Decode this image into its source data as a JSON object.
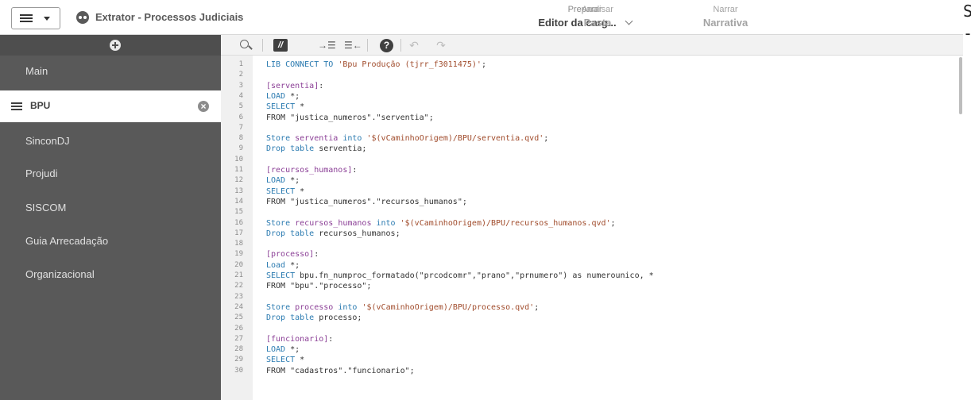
{
  "header": {
    "app_title": "Extrator - Processos Judiciais",
    "steps": [
      {
        "label": "Preparar",
        "value": "Editor da carg..."
      },
      {
        "label": "Analisar",
        "value": "Pasta"
      },
      {
        "label": "Narrar",
        "value": "Narrativa"
      }
    ],
    "edge_text": "S\n-"
  },
  "sidebar": {
    "items": [
      {
        "label": "Main",
        "active": false
      },
      {
        "label": "BPU",
        "active": true
      },
      {
        "label": "SinconDJ",
        "active": false
      },
      {
        "label": "Projudi",
        "active": false
      },
      {
        "label": "SISCOM",
        "active": false
      },
      {
        "label": "Guia Arrecadação",
        "active": false
      },
      {
        "label": "Organizacional",
        "active": false
      }
    ]
  },
  "toolbar": {
    "comment_glyph": "//",
    "indent_glyph": "→☰",
    "outdent_glyph": "☰←",
    "help_glyph": "?",
    "undo_glyph": "↶",
    "redo_glyph": "↷"
  },
  "colors": {
    "sidebar_bg": "#595959",
    "active_item_bg": "#ffffff",
    "keyword": "#2a7ab0",
    "label": "#8b3f96",
    "string": "#a04b2b"
  },
  "editor": {
    "lines": [
      {
        "n": "1",
        "parts": [
          [
            "kw",
            "LIB CONNECT TO "
          ],
          [
            "str",
            "'Bpu Produção (tjrr_f3011475)'"
          ],
          [
            "",
            "; "
          ]
        ]
      },
      {
        "n": "2",
        "parts": []
      },
      {
        "n": "3",
        "parts": [
          [
            "lbl",
            "[serventia]"
          ],
          [
            "",
            ":"
          ]
        ]
      },
      {
        "n": "4",
        "parts": [
          [
            "kw",
            "LOAD"
          ],
          [
            "",
            " *;"
          ]
        ]
      },
      {
        "n": "5",
        "parts": [
          [
            "kw",
            "SELECT"
          ],
          [
            "",
            " *"
          ]
        ]
      },
      {
        "n": "6",
        "parts": [
          [
            "",
            "FROM \"justica_numeros\".\"serventia\";"
          ]
        ]
      },
      {
        "n": "7",
        "parts": []
      },
      {
        "n": "8",
        "parts": [
          [
            "kw",
            "Store"
          ],
          [
            "",
            " "
          ],
          [
            "lbl",
            "serventia"
          ],
          [
            "",
            " "
          ],
          [
            "kw",
            "into"
          ],
          [
            "",
            " "
          ],
          [
            "str",
            "'$(vCaminhoOrigem)/BPU/serventia.qvd'"
          ],
          [
            "",
            ";"
          ]
        ]
      },
      {
        "n": "9",
        "parts": [
          [
            "kw",
            "Drop table"
          ],
          [
            "",
            " serventia;"
          ]
        ]
      },
      {
        "n": "10",
        "parts": []
      },
      {
        "n": "11",
        "parts": [
          [
            "lbl",
            "[recursos_humanos]"
          ],
          [
            "",
            ":"
          ]
        ]
      },
      {
        "n": "12",
        "parts": [
          [
            "kw",
            "LOAD"
          ],
          [
            "",
            " *;"
          ]
        ]
      },
      {
        "n": "13",
        "parts": [
          [
            "kw",
            "SELECT"
          ],
          [
            "",
            " *"
          ]
        ]
      },
      {
        "n": "14",
        "parts": [
          [
            "",
            "FROM \"justica_numeros\".\"recursos_humanos\";"
          ]
        ]
      },
      {
        "n": "15",
        "parts": []
      },
      {
        "n": "16",
        "parts": [
          [
            "kw",
            "Store"
          ],
          [
            "",
            " "
          ],
          [
            "lbl",
            "recursos_humanos"
          ],
          [
            "",
            " "
          ],
          [
            "kw",
            "into"
          ],
          [
            "",
            " "
          ],
          [
            "str",
            "'$(vCaminhoOrigem)/BPU/recursos_humanos.qvd'"
          ],
          [
            "",
            ";"
          ]
        ]
      },
      {
        "n": "17",
        "parts": [
          [
            "kw",
            "Drop table"
          ],
          [
            "",
            " recursos_humanos;"
          ]
        ]
      },
      {
        "n": "18",
        "parts": []
      },
      {
        "n": "19",
        "parts": [
          [
            "lbl",
            "[processo]"
          ],
          [
            "",
            ":"
          ]
        ]
      },
      {
        "n": "20",
        "parts": [
          [
            "kw",
            "Load"
          ],
          [
            "",
            " *;"
          ]
        ]
      },
      {
        "n": "21",
        "parts": [
          [
            "kw",
            "SELECT"
          ],
          [
            "",
            " bpu.fn_numproc_formatado(\"prcodcomr\",\"prano\",\"prnumero\") as numerounico, *"
          ]
        ]
      },
      {
        "n": "22",
        "parts": [
          [
            "",
            "FROM \"bpu\".\"processo\";"
          ]
        ]
      },
      {
        "n": "23",
        "parts": []
      },
      {
        "n": "24",
        "parts": [
          [
            "kw",
            "Store"
          ],
          [
            "",
            " "
          ],
          [
            "lbl",
            "processo"
          ],
          [
            "",
            " "
          ],
          [
            "kw",
            "into"
          ],
          [
            "",
            " "
          ],
          [
            "str",
            "'$(vCaminhoOrigem)/BPU/processo.qvd'"
          ],
          [
            "",
            ";"
          ]
        ]
      },
      {
        "n": "25",
        "parts": [
          [
            "kw",
            "Drop table"
          ],
          [
            "",
            " processo;"
          ]
        ]
      },
      {
        "n": "26",
        "parts": []
      },
      {
        "n": "27",
        "parts": [
          [
            "lbl",
            "[funcionario]"
          ],
          [
            "",
            ":"
          ]
        ]
      },
      {
        "n": "28",
        "parts": [
          [
            "kw",
            "LOAD"
          ],
          [
            "",
            " *;"
          ]
        ]
      },
      {
        "n": "29",
        "parts": [
          [
            "kw",
            "SELECT"
          ],
          [
            "",
            " *"
          ]
        ]
      },
      {
        "n": "30",
        "parts": [
          [
            "",
            "FROM \"cadastros\".\"funcionario\";"
          ]
        ]
      }
    ]
  }
}
